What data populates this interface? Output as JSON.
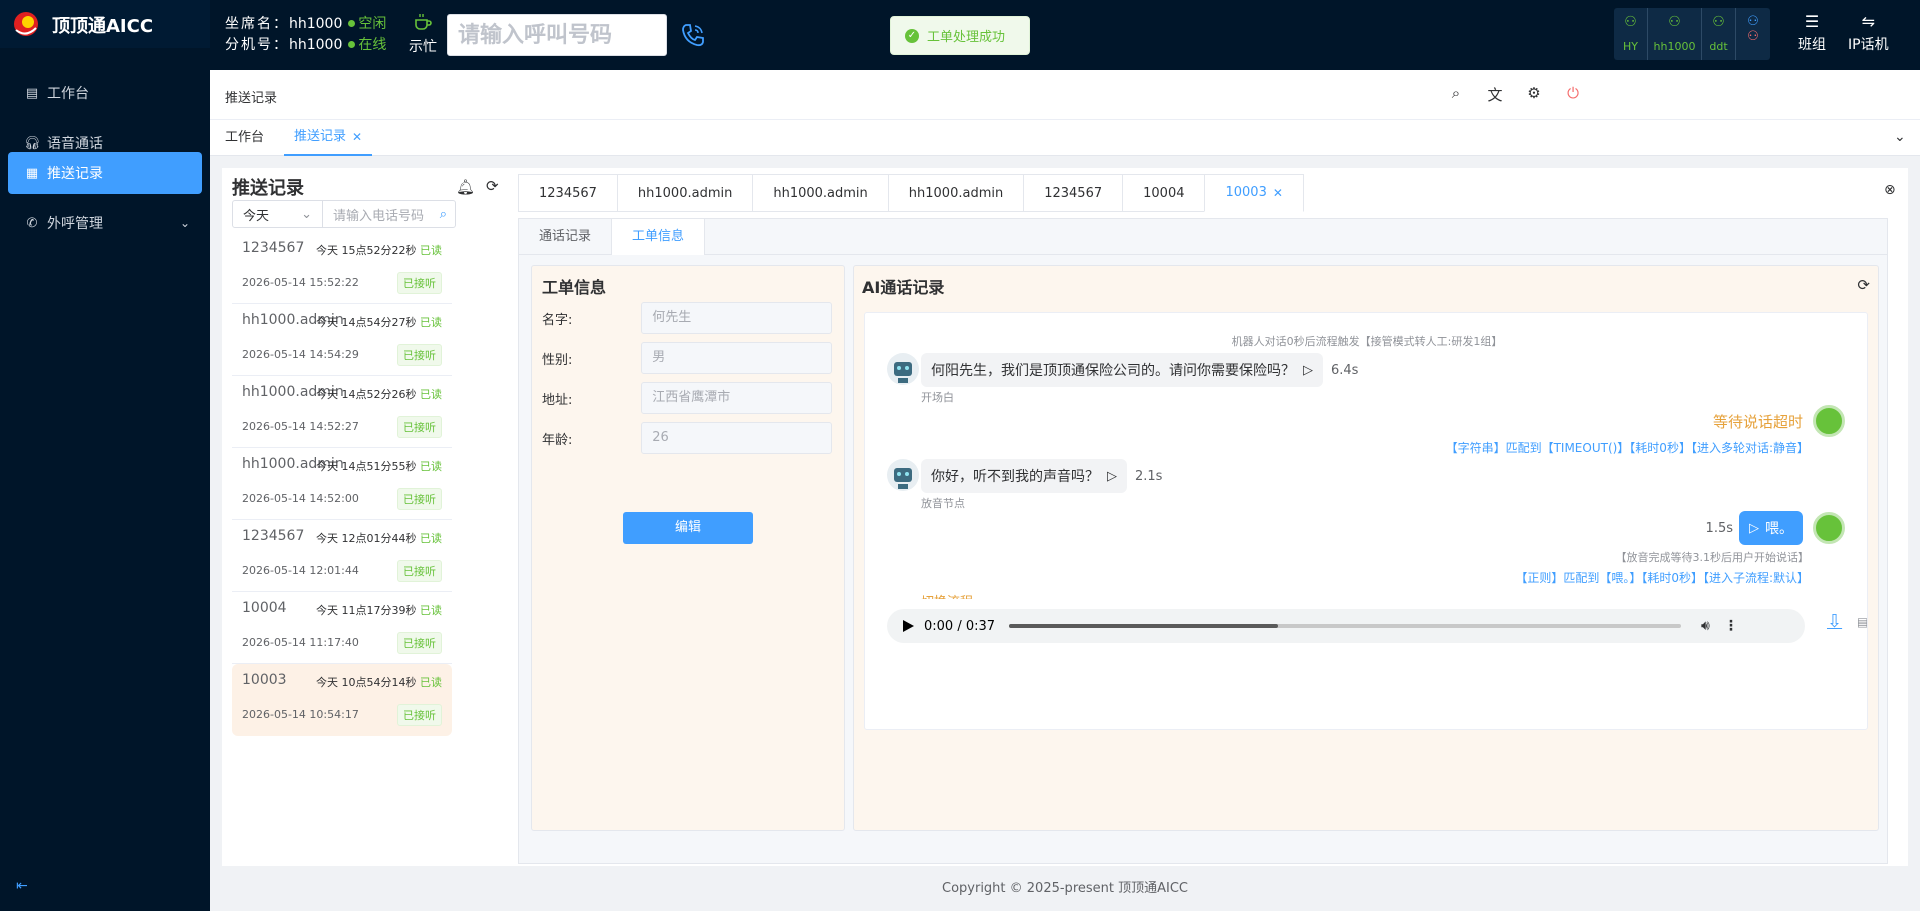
{
  "app": {
    "title": "顶顶通AICC"
  },
  "agent": {
    "seat_label": "坐席名：",
    "seat_value": "hh1000",
    "seat_status": "空闲",
    "ext_label": "分机号：",
    "ext_value": "hh1000",
    "ext_status": "在线"
  },
  "busy_label": "示忙",
  "dial": {
    "placeholder": "请输入呼叫号码"
  },
  "toast": {
    "text": "工单处理成功"
  },
  "lines": [
    {
      "label": "HY"
    },
    {
      "label": "hh1000"
    },
    {
      "label": "ddt"
    }
  ],
  "topbuttons": {
    "group": "班组",
    "ipphone": "IP话机"
  },
  "menu": [
    {
      "label": "工作台"
    },
    {
      "label": "语音通话"
    },
    {
      "label": "推送记录"
    },
    {
      "label": "外呼管理"
    }
  ],
  "breadcrumb": "推送记录",
  "tags": [
    {
      "label": "工作台"
    },
    {
      "label": "推送记录"
    }
  ],
  "left_panel": {
    "title": "推送记录",
    "filter_value": "今天",
    "search_placeholder": "请输入电话号码",
    "records": [
      {
        "number": "1234567",
        "time": "今天 15点52分22秒",
        "read": "已读",
        "date": "2026-05-14 15:52:22",
        "status": "已接听"
      },
      {
        "number": "hh1000.admin",
        "time": "今天 14点54分27秒",
        "read": "已读",
        "date": "2026-05-14 14:54:29",
        "status": "已接听"
      },
      {
        "number": "hh1000.admin",
        "time": "今天 14点52分26秒",
        "read": "已读",
        "date": "2026-05-14 14:52:27",
        "status": "已接听"
      },
      {
        "number": "hh1000.admin",
        "time": "今天 14点51分55秒",
        "read": "已读",
        "date": "2026-05-14 14:52:00",
        "status": "已接听"
      },
      {
        "number": "1234567",
        "time": "今天 12点01分44秒",
        "read": "已读",
        "date": "2026-05-14 12:01:44",
        "status": "已接听"
      },
      {
        "number": "10004",
        "time": "今天 11点17分39秒",
        "read": "已读",
        "date": "2026-05-14 11:17:40",
        "status": "已接听"
      },
      {
        "number": "10003",
        "time": "今天 10点54分14秒",
        "read": "已读",
        "date": "2026-05-14 10:54:17",
        "status": "已接听"
      }
    ]
  },
  "session_tabs": [
    {
      "label": "1234567"
    },
    {
      "label": "hh1000.admin"
    },
    {
      "label": "hh1000.admin"
    },
    {
      "label": "hh1000.admin"
    },
    {
      "label": "1234567"
    },
    {
      "label": "10004"
    },
    {
      "label": "10003"
    }
  ],
  "inner_tabs": [
    {
      "label": "通话记录"
    },
    {
      "label": "工单信息"
    }
  ],
  "work_order": {
    "title": "工单信息",
    "fields": [
      {
        "label": "名字:",
        "value": "何先生"
      },
      {
        "label": "性别:",
        "value": "男"
      },
      {
        "label": "地址:",
        "value": "江西省鹰潭市"
      },
      {
        "label": "年龄:",
        "value": "26"
      }
    ],
    "edit_button": "编辑"
  },
  "ai_record": {
    "title": "AI通话记录",
    "system_note": "机器人对话0秒后流程触发【接管模式转人工:研发1组】",
    "msg1": {
      "text": "何阳先生，我们是顶顶通保险公司的。请问你需要保险吗？",
      "duration": "6.4s",
      "node": "开场白"
    },
    "timeout": {
      "text": "等待说话超时",
      "match": "【字符串】匹配到【TIMEOUT()】【耗时0秒】【进入多轮对话:静音】"
    },
    "msg2": {
      "text": "你好，听不到我的声音吗？",
      "duration": "2.1s",
      "node": "放音节点"
    },
    "user_msg": {
      "text": "喂。",
      "duration": "1.5s",
      "note": "【放音完成等待3.1秒后用户开始说话】",
      "match": "【正则】匹配到【喂。】【耗时0秒】【进入子流程:默认】"
    },
    "partial": "切换流程",
    "audio": {
      "time": "0:00 / 0:37",
      "progress": 0.4
    }
  },
  "footer": "Copyright © 2025-present  顶顶通AICC",
  "colors": {
    "primary": "#409eff",
    "success": "#67c23a",
    "warning": "#e6a23c",
    "sidebar": "#001529"
  }
}
